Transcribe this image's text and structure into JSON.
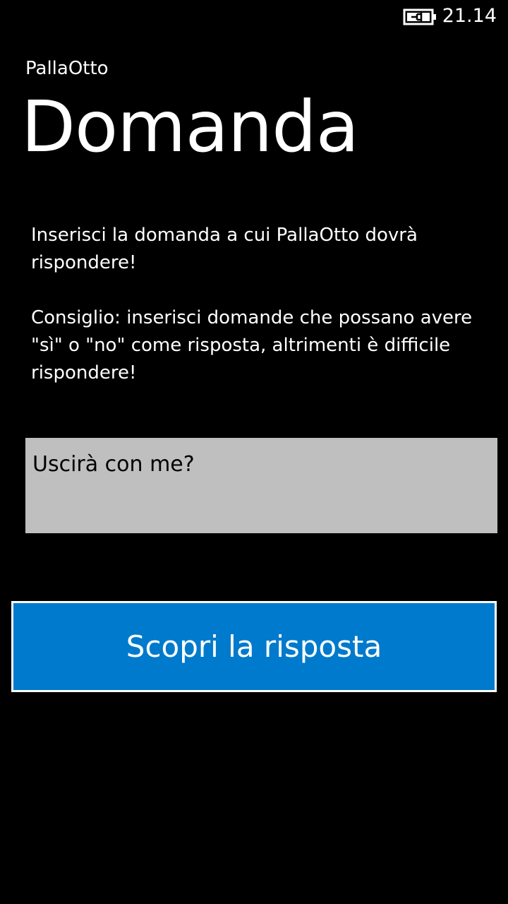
{
  "status_bar": {
    "time": "21.14",
    "battery_icon": "battery-charging-icon"
  },
  "header": {
    "app_title": "PallaOtto",
    "page_title": "Domanda"
  },
  "instructions": {
    "paragraph_1": "Inserisci  la domanda a cui PallaOtto dovrà rispondere!",
    "paragraph_2": "Consiglio: inserisci domande che possano avere \"sì\" o \"no\" come risposta, altrimenti è difficile rispondere!"
  },
  "question_input": {
    "value": "Uscirà con me?"
  },
  "submit_button": {
    "label": "Scopri la risposta"
  },
  "colors": {
    "background": "#000000",
    "accent": "#007acc",
    "input_background": "#bfbfbf",
    "text": "#ffffff"
  }
}
